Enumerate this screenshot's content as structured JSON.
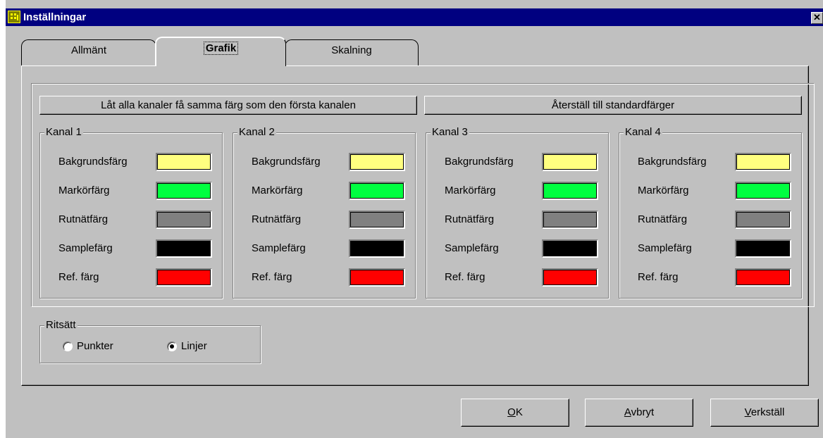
{
  "window": {
    "title": "Inställningar",
    "close_glyph": "✕"
  },
  "tabs": [
    {
      "label": "Allmänt"
    },
    {
      "label": "Grafik"
    },
    {
      "label": "Skalning"
    }
  ],
  "active_tab": "Grafik",
  "actions": {
    "same_color_label": "Låt alla kanaler få samma färg som den första kanalen",
    "reset_label": "Återställ till standardfärger"
  },
  "row_labels": [
    "Bakgrundsfärg",
    "Markörfärg",
    "Rutnätfärg",
    "Samplefärg",
    "Ref. färg"
  ],
  "colors": {
    "background": "#ffff80",
    "cursor": "#00ff40",
    "grid": "#808080",
    "sample": "#000000",
    "ref": "#ff0000"
  },
  "channels": [
    {
      "title": "Kanal 1"
    },
    {
      "title": "Kanal 2"
    },
    {
      "title": "Kanal 3"
    },
    {
      "title": "Kanal 4"
    }
  ],
  "draw_mode": {
    "title": "Ritsätt",
    "options": [
      {
        "label": "Punkter",
        "selected": false
      },
      {
        "label": "Linjer",
        "selected": true
      }
    ]
  },
  "footer": {
    "ok_mnemonic": "O",
    "ok_rest": "K",
    "cancel_mnemonic": "A",
    "cancel_rest": "vbryt",
    "apply_mnemonic": "V",
    "apply_rest": "erkställ"
  }
}
